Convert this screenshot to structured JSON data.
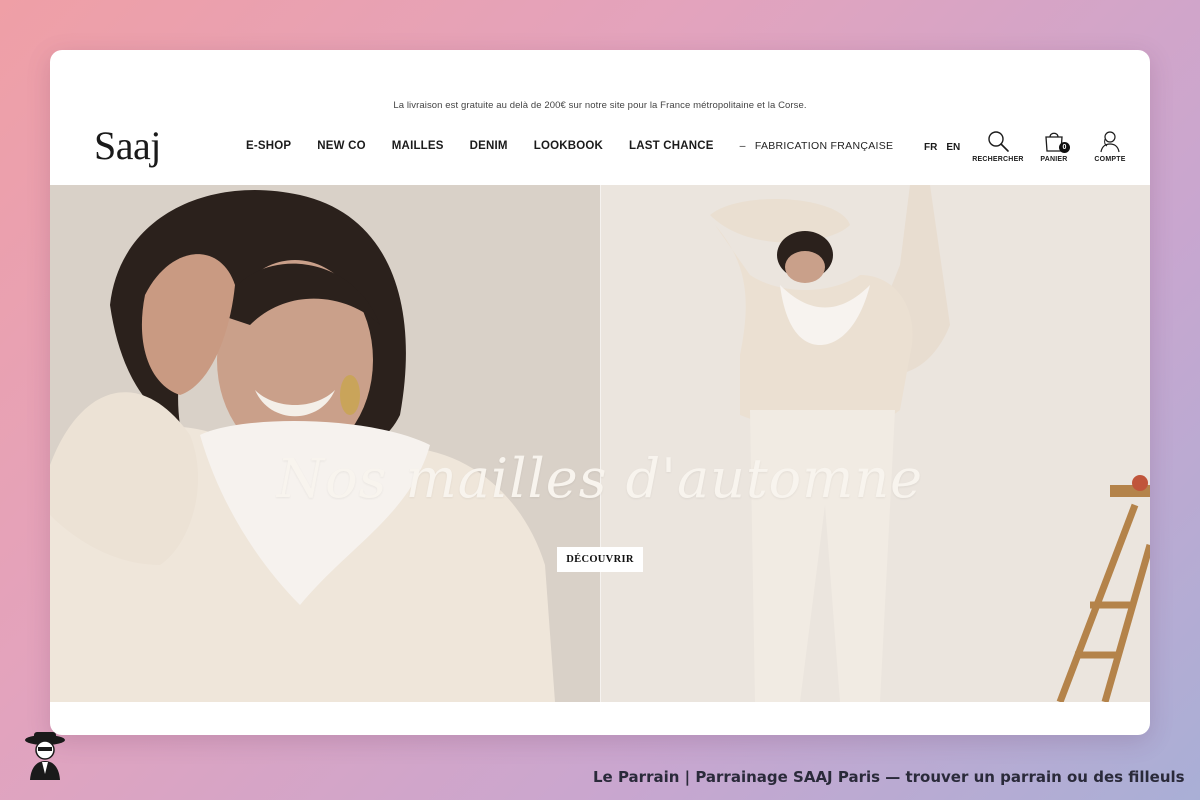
{
  "promo": {
    "text": "La livraison est gratuite au delà de 200€ sur notre site pour la France métropolitaine et la Corse."
  },
  "header": {
    "logo": "Saaj",
    "nav": [
      "E-SHOP",
      "NEW CO",
      "MAILLES",
      "DENIM",
      "LOOKBOOK",
      "LAST CHANCE"
    ],
    "nav_extra": {
      "dash": "–",
      "label": "FABRICATION FRANÇAISE"
    },
    "languages": [
      "FR",
      "EN"
    ],
    "tools": {
      "search": {
        "label": "RECHERCHER",
        "icon": "search-icon"
      },
      "cart": {
        "label": "PANIER",
        "icon": "bag-icon",
        "count": "0"
      },
      "account": {
        "label": "COMPTE",
        "icon": "user-icon"
      }
    }
  },
  "hero": {
    "title": "Nos mailles d'automne",
    "cta": "DÉCOUVRIR"
  },
  "footer": {
    "caption": "Le Parrain | Parrainage SAAJ Paris — trouver un parrain ou des filleuls"
  },
  "colors": {
    "background_gradient": [
      "#ef9fa6",
      "#c9a6cf",
      "#a9afd6"
    ],
    "hero_base": "#e6ded5",
    "sweater": "#efe6da",
    "text_dark": "#1b1b1b"
  }
}
